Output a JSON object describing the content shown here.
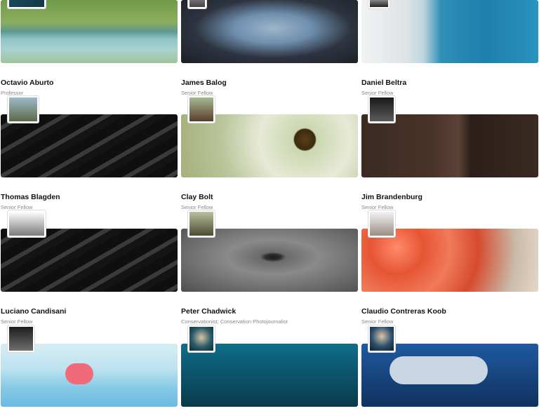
{
  "profiles": [
    {
      "name": "Octavio Aburto",
      "role": "Professor",
      "banner": "river-water-image",
      "avatar": "diver-avatar"
    },
    {
      "name": "James Balog",
      "role": "Senior Fellow",
      "banner": "iceberg-image",
      "avatar": "person-avatar"
    },
    {
      "name": "Daniel Beltra",
      "role": "Senior Fellow",
      "banner": "ice-sea-aerial-image",
      "avatar": "person-avatar"
    },
    {
      "name": "Thomas Blagden",
      "role": "Senior Fellow",
      "banner": "striped-pattern-image",
      "avatar": "person-avatar"
    },
    {
      "name": "Clay Bolt",
      "role": "Senior Fellow",
      "banner": "bumblebee-flowers-image",
      "avatar": "person-avatar"
    },
    {
      "name": "Jim Brandenburg",
      "role": "Senior Fellow",
      "banner": "wolf-dark-image",
      "avatar": "person-avatar"
    },
    {
      "name": "Luciano Candisani",
      "role": "Senior Fellow",
      "banner": "striped-pattern-image",
      "avatar": "person-avatar"
    },
    {
      "name": "Peter Chadwick",
      "role": "Conservationist; Conservation Photojournalist",
      "banner": "rhino-eye-image",
      "avatar": "person-avatar"
    },
    {
      "name": "Claudio Contreras Koob",
      "role": "Senior Fellow",
      "banner": "flamingo-flock-image",
      "avatar": "person-avatar"
    },
    {
      "name": "",
      "role": "",
      "banner": "flamingo-feet-image",
      "avatar": "person-avatar"
    },
    {
      "name": "",
      "role": "",
      "banner": "underwater-eels-image",
      "avatar": "diver-avatar"
    },
    {
      "name": "",
      "role": "",
      "banner": "tuna-fish-image",
      "avatar": "diver-avatar"
    }
  ]
}
